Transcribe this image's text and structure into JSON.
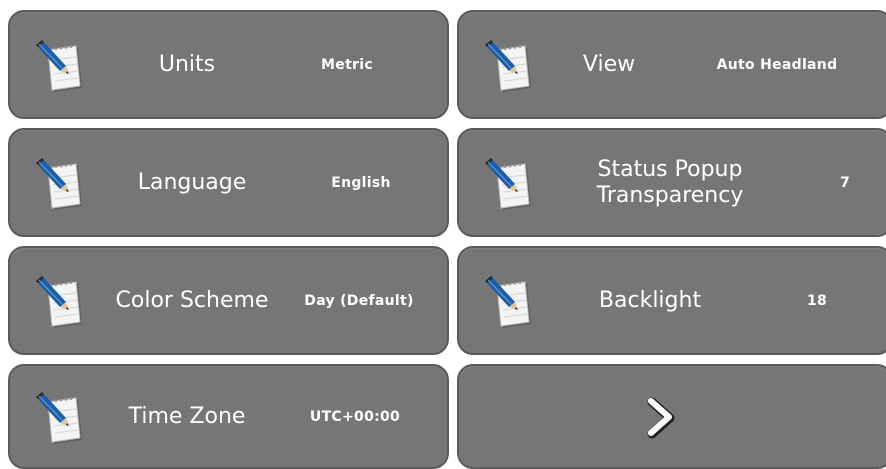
{
  "settings": {
    "units": {
      "label": "Units",
      "value": "Metric"
    },
    "language": {
      "label": "Language",
      "value": "English"
    },
    "color_scheme": {
      "label": "Color Scheme",
      "value": "Day (Default)"
    },
    "time_zone": {
      "label": "Time Zone",
      "value": "UTC+00:00"
    },
    "view": {
      "label": "View",
      "value": "Auto Headland"
    },
    "status_popup_transparency": {
      "label_line1": "Status Popup",
      "label_line2": "Transparency",
      "value": "7"
    },
    "backlight": {
      "label": "Backlight",
      "value": "18"
    }
  },
  "icons": {
    "edit": "notepad-pencil-icon",
    "next": "chevron-right-icon"
  },
  "colors": {
    "tile_background": "#767676",
    "tile_border": "#5a5a5a",
    "text": "#ffffff"
  }
}
